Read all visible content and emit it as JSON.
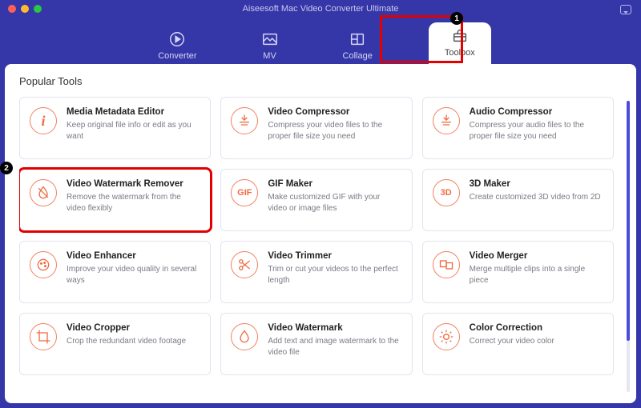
{
  "app_title": "Aiseesoft Mac Video Converter Ultimate",
  "tabs": [
    {
      "label": "Converter"
    },
    {
      "label": "MV"
    },
    {
      "label": "Collage"
    },
    {
      "label": "Toolbox"
    }
  ],
  "section_title": "Popular Tools",
  "tools": [
    {
      "title": "Media Metadata Editor",
      "desc": "Keep original file info or edit as you want",
      "icon": "i"
    },
    {
      "title": "Video Compressor",
      "desc": "Compress your video files to the proper file size you need",
      "icon": "⇣"
    },
    {
      "title": "Audio Compressor",
      "desc": "Compress your audio files to the proper file size you need",
      "icon": "⇣"
    },
    {
      "title": "Video Watermark Remover",
      "desc": "Remove the watermark from the video flexibly",
      "icon": "◑"
    },
    {
      "title": "GIF Maker",
      "desc": "Make customized GIF with your video or image files",
      "icon": "GIF"
    },
    {
      "title": "3D Maker",
      "desc": "Create customized 3D video from 2D",
      "icon": "3D"
    },
    {
      "title": "Video Enhancer",
      "desc": "Improve your video quality in several ways",
      "icon": "✎"
    },
    {
      "title": "Video Trimmer",
      "desc": "Trim or cut your videos to the perfect length",
      "icon": "✂"
    },
    {
      "title": "Video Merger",
      "desc": "Merge multiple clips into a single piece",
      "icon": "⧉"
    },
    {
      "title": "Video Cropper",
      "desc": "Crop the redundant video footage",
      "icon": "◫"
    },
    {
      "title": "Video Watermark",
      "desc": "Add text and image watermark to the video file",
      "icon": "◒"
    },
    {
      "title": "Color Correction",
      "desc": "Correct your video color",
      "icon": "☀"
    }
  ],
  "callouts": {
    "tab": "1",
    "card": "2"
  }
}
